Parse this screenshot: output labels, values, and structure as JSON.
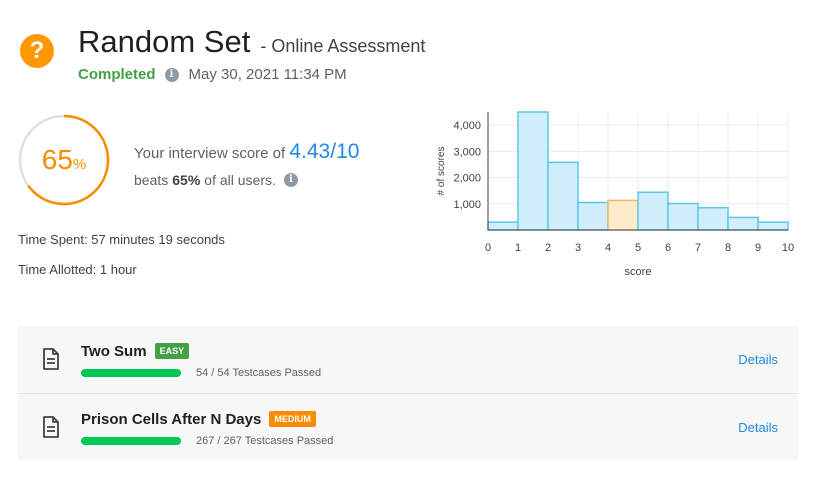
{
  "header": {
    "icon": "question-icon",
    "title": "Random Set",
    "subtitle": "- Online Assessment",
    "status": "Completed",
    "date": "May 30, 2021 11:34 PM"
  },
  "score": {
    "percent_number": "65",
    "percent_sign": "%",
    "percent_value": 65,
    "line1_prefix": "Your interview score of",
    "value": "4.43/10",
    "beats_prefix": "beats",
    "beats_value": "65%",
    "beats_suffix": "of all users."
  },
  "time": {
    "spent": "Time Spent: 57 minutes 19 seconds",
    "allotted": "Time Allotted: 1 hour"
  },
  "chart_data": {
    "type": "bar",
    "x_edges": [
      0,
      1,
      2,
      3,
      4,
      5,
      6,
      7,
      8,
      9,
      10
    ],
    "values": [
      300,
      4500,
      2580,
      1050,
      1130,
      1440,
      1010,
      850,
      480,
      300
    ],
    "highlight_bin": 4,
    "xlabel": "score",
    "ylabel": "# of scores",
    "yticks": [
      1000,
      2000,
      3000,
      4000
    ],
    "ytick_labels": [
      "1,000",
      "2,000",
      "3,000",
      "4,000"
    ],
    "xtick_labels": [
      "0",
      "1",
      "2",
      "3",
      "4",
      "5",
      "6",
      "7",
      "8",
      "9",
      "10"
    ],
    "ylim": [
      0,
      4500
    ],
    "xlim": [
      0,
      10
    ],
    "grid": true,
    "colors": {
      "bar": "#d1eefc",
      "bar_stroke": "#5ac8ec",
      "highlight": "#fdebcc",
      "highlight_stroke": "#f5b66a"
    }
  },
  "problems": [
    {
      "title": "Two Sum",
      "difficulty": "EASY",
      "passed_fraction": 1.0,
      "passed_text": "54 / 54 Testcases Passed",
      "details": "Details"
    },
    {
      "title": "Prison Cells After N Days",
      "difficulty": "MEDIUM",
      "passed_fraction": 1.0,
      "passed_text": "267 / 267 Testcases Passed",
      "details": "Details"
    }
  ]
}
